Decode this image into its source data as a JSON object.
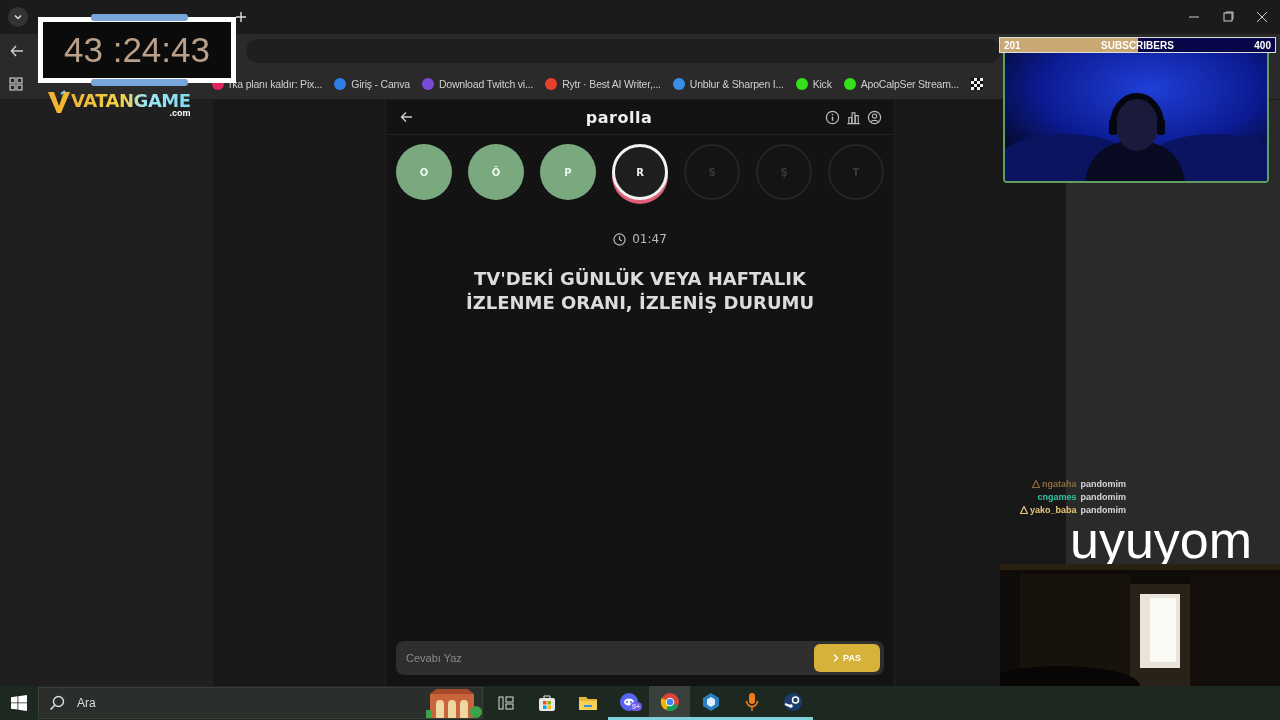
{
  "browser": {
    "bookmarks": [
      {
        "label": "rka planı kaldır: Pix...",
        "color": "#e0245e"
      },
      {
        "label": "Giriş - Canva",
        "color": "#2f7ee8"
      },
      {
        "label": "Download Twitch vi...",
        "color": "#7a4ad8"
      },
      {
        "label": "Rytr · Best AI Writer,...",
        "color": "#e8402a"
      },
      {
        "label": "Unblur & Sharpen I...",
        "color": "#3a8ee8"
      },
      {
        "label": "Kick",
        "color": "#35e01a"
      },
      {
        "label": "ApoCalpSer Stream...",
        "color": "#35e01a"
      }
    ]
  },
  "game": {
    "title": "parolla",
    "letters": [
      {
        "letter": "O",
        "answered": true,
        "current": false
      },
      {
        "letter": "Ö",
        "answered": true,
        "current": false
      },
      {
        "letter": "P",
        "answered": true,
        "current": false
      },
      {
        "letter": "R",
        "answered": false,
        "current": true
      },
      {
        "letter": "S",
        "answered": false,
        "current": false
      },
      {
        "letter": "Ş",
        "answered": false,
        "current": false
      },
      {
        "letter": "T",
        "answered": false,
        "current": false
      }
    ],
    "timer": "01:47",
    "question_lines": [
      "TV'DEKİ GÜNLÜK VEYA HAFTALIK",
      "İZLENME ORANI, İZLENİŞ DURUMU"
    ],
    "answer": {
      "placeholder": "Cevabı Yaz"
    },
    "pass_button": "PAS"
  },
  "taskbar": {
    "search": {
      "placeholder": "Ara"
    },
    "apps": [
      {
        "kind": "taskview",
        "open": false,
        "active": false
      },
      {
        "kind": "store",
        "open": false,
        "active": false
      },
      {
        "kind": "folder",
        "open": false,
        "active": false
      },
      {
        "kind": "chat",
        "open": true,
        "active": false,
        "badge": "9+"
      },
      {
        "kind": "browser",
        "open": true,
        "active": true
      },
      {
        "kind": "cube",
        "open": true,
        "active": false
      },
      {
        "kind": "mic",
        "open": true,
        "active": false
      },
      {
        "kind": "steam",
        "open": true,
        "active": false
      }
    ]
  },
  "stream_overlay": {
    "timer": "43 :24:43",
    "logo": {
      "name": "VATANGAME",
      "suffix": ".com"
    },
    "subscriber_goal": {
      "current": "201",
      "label": "SUBSCRIBERS",
      "target": "400",
      "level": 0.5025
    },
    "chat": [
      {
        "user": "ngataha",
        "message": "pandomim",
        "color": "#8a6a3c",
        "badge": true
      },
      {
        "user": "cngames",
        "message": "pandomim",
        "color": "#2fc7a0",
        "badge": false
      },
      {
        "user": "yako_baba",
        "message": "pandomim",
        "color": "#e8c77a",
        "badge": true
      }
    ],
    "caption": "uyuyom"
  }
}
